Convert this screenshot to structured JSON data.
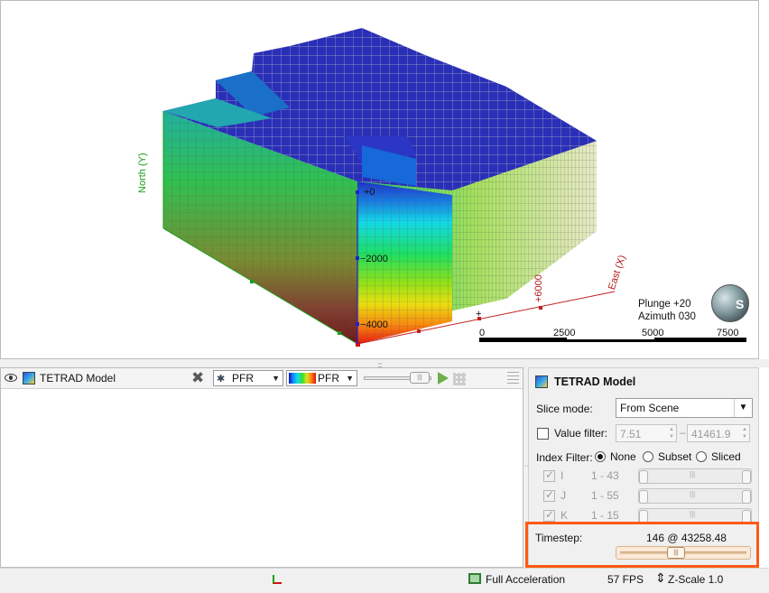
{
  "viewport": {
    "north_label": "North (Y)",
    "east_label": "East (X)",
    "z_ticks": [
      "+0",
      "−2000",
      "−4000"
    ],
    "east_tick": "+6000",
    "plunge": "Plunge +20",
    "azimuth": "Azimuth 030",
    "compass_letter": "S",
    "scale_labels": [
      "0",
      "2500",
      "5000",
      "7500"
    ]
  },
  "scene_panel": {
    "title": "TETRAD Model",
    "attribute_select": "PFR",
    "colormap_select": "PFR",
    "icons": [
      "eye-icon",
      "model-icon",
      "delete-icon",
      "play-icon",
      "grid-icon",
      "list-icon"
    ]
  },
  "properties": {
    "title": "TETRAD Model",
    "slice_mode_label": "Slice mode:",
    "slice_mode_value": "From Scene",
    "value_filter_label": "Value filter:",
    "value_filter_min": "7.51",
    "value_filter_max": "41461.9",
    "index_filter_label": "Index Filter:",
    "index_options": [
      "None",
      "Subset",
      "Sliced"
    ],
    "index_selected": "None",
    "index_rows": [
      {
        "letter": "I",
        "range": "1 - 43"
      },
      {
        "letter": "J",
        "range": "1 - 55"
      },
      {
        "letter": "K",
        "range": "1 - 15"
      }
    ],
    "timestep_label": "Timestep:",
    "timestep_value": "146 @ 43258.48"
  },
  "status": {
    "acceleration": "Full Acceleration",
    "fps": "57 FPS",
    "zscale": "Z-Scale 1.0"
  },
  "colors": {
    "highlight": "#ff5a14",
    "north_axis": "#1a9e1a",
    "east_axis": "#b31b1b"
  }
}
